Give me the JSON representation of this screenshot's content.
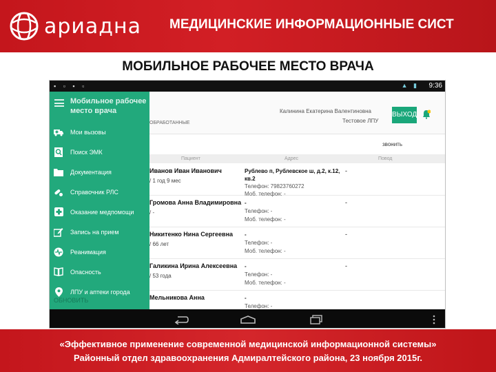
{
  "header": {
    "logo_text": "ариадна",
    "title": "МЕДИЦИНСКИЕ ИНФОРМАЦИОННЫЕ СИСТ"
  },
  "slide_title": "МОБИЛЬНОЕ РАБОЧЕЕ МЕСТО ВРАЧА",
  "app": {
    "status": {
      "time": "9:36"
    },
    "drawer_title_1": "Мобильное рабочее",
    "drawer_title_2": "место врача",
    "menu": [
      {
        "label": "Мои вызовы",
        "icon": "ambulance-icon"
      },
      {
        "label": "Поиск ЭМК",
        "icon": "search-card-icon"
      },
      {
        "label": "Документация",
        "icon": "folder-icon"
      },
      {
        "label": "Справочник РЛС",
        "icon": "pills-icon"
      },
      {
        "label": "Оказание медпомощи",
        "icon": "medical-cross-icon"
      },
      {
        "label": "Запись на прием",
        "icon": "edit-icon"
      },
      {
        "label": "Реанимация",
        "icon": "resuscitation-icon"
      },
      {
        "label": "Опасность",
        "icon": "book-icon"
      },
      {
        "label": "ЛПУ и аптеки города",
        "icon": "location-pin-icon"
      }
    ],
    "drawer_footer": "ОБНОВИТЬ",
    "user": {
      "name": "Калинина Екатерина Валентиновна",
      "org": "Тестовое ЛПУ"
    },
    "exit_label": "ВЫХОД",
    "subtab": "ОБРАБОТАННЫЕ",
    "filter_label": "звонить",
    "columns": [
      "Пациент",
      "Адрес",
      "Повод"
    ],
    "rows": [
      {
        "name": "Иванов Иван Иванович",
        "age": "/ 1 год 9 мес",
        "address": "Рублево п, Рублевское ш, д.2, к.12, кв.2",
        "phone": "Телефон: 79823760272",
        "mobile": "Моб. телефон: -",
        "extra": "-"
      },
      {
        "name": "Громова Анна Владимировна",
        "age": "/ -",
        "address": "-",
        "phone": "Телефон: -",
        "mobile": "Моб. телефон: -",
        "extra": "-"
      },
      {
        "name": "Никитенко Нина Сергеевна",
        "age": "/ 66 лет",
        "address": "-",
        "phone": "Телефон: -",
        "mobile": "Моб. телефон: -",
        "extra": "-"
      },
      {
        "name": "Галикина Ирина Алексеевна",
        "age": "/ 53 года",
        "address": "-",
        "phone": "Телефон: -",
        "mobile": "Моб. телефон: -",
        "extra": "-"
      },
      {
        "name": "Мельникова Анна",
        "age": "",
        "address": "-",
        "phone": "Телефон: -",
        "mobile": "",
        "extra": ""
      }
    ]
  },
  "footer": {
    "line1": "«Эффективное применение современной медицинской информационной системы»",
    "line2": "Районный отдел здравоохранения Адмиралтейского района, 23 ноября 2015г."
  },
  "colors": {
    "brand_red": "#c4161c",
    "drawer_green": "#22a97c",
    "exit_green": "#1aa77a"
  }
}
